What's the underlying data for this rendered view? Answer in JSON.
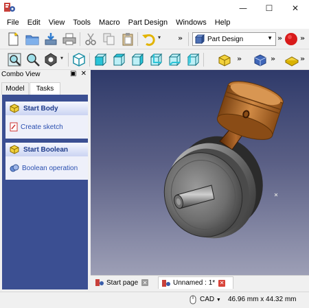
{
  "menu": [
    "File",
    "Edit",
    "View",
    "Tools",
    "Macro",
    "Part Design",
    "Windows",
    "Help"
  ],
  "window_controls": {
    "minimize": "—",
    "maximize": "☐",
    "close": "✕"
  },
  "workbench_selector": {
    "value": "Part Design"
  },
  "combo_view": {
    "title": "Combo View",
    "tabs": [
      "Model",
      "Tasks"
    ],
    "sections": [
      {
        "heading": "Start Body",
        "action": "Create sketch"
      },
      {
        "heading": "Start Boolean",
        "action": "Boolean operation"
      }
    ]
  },
  "document_tabs": [
    {
      "label": "Start page"
    },
    {
      "label": "Unnamed : 1*"
    }
  ],
  "status": {
    "navigation": "CAD",
    "dimensions": "46.96 mm x 44.32 mm"
  },
  "colors": {
    "accent": "#3b4f92",
    "close_red": "#c8403a",
    "record_red": "#d81a1a"
  }
}
